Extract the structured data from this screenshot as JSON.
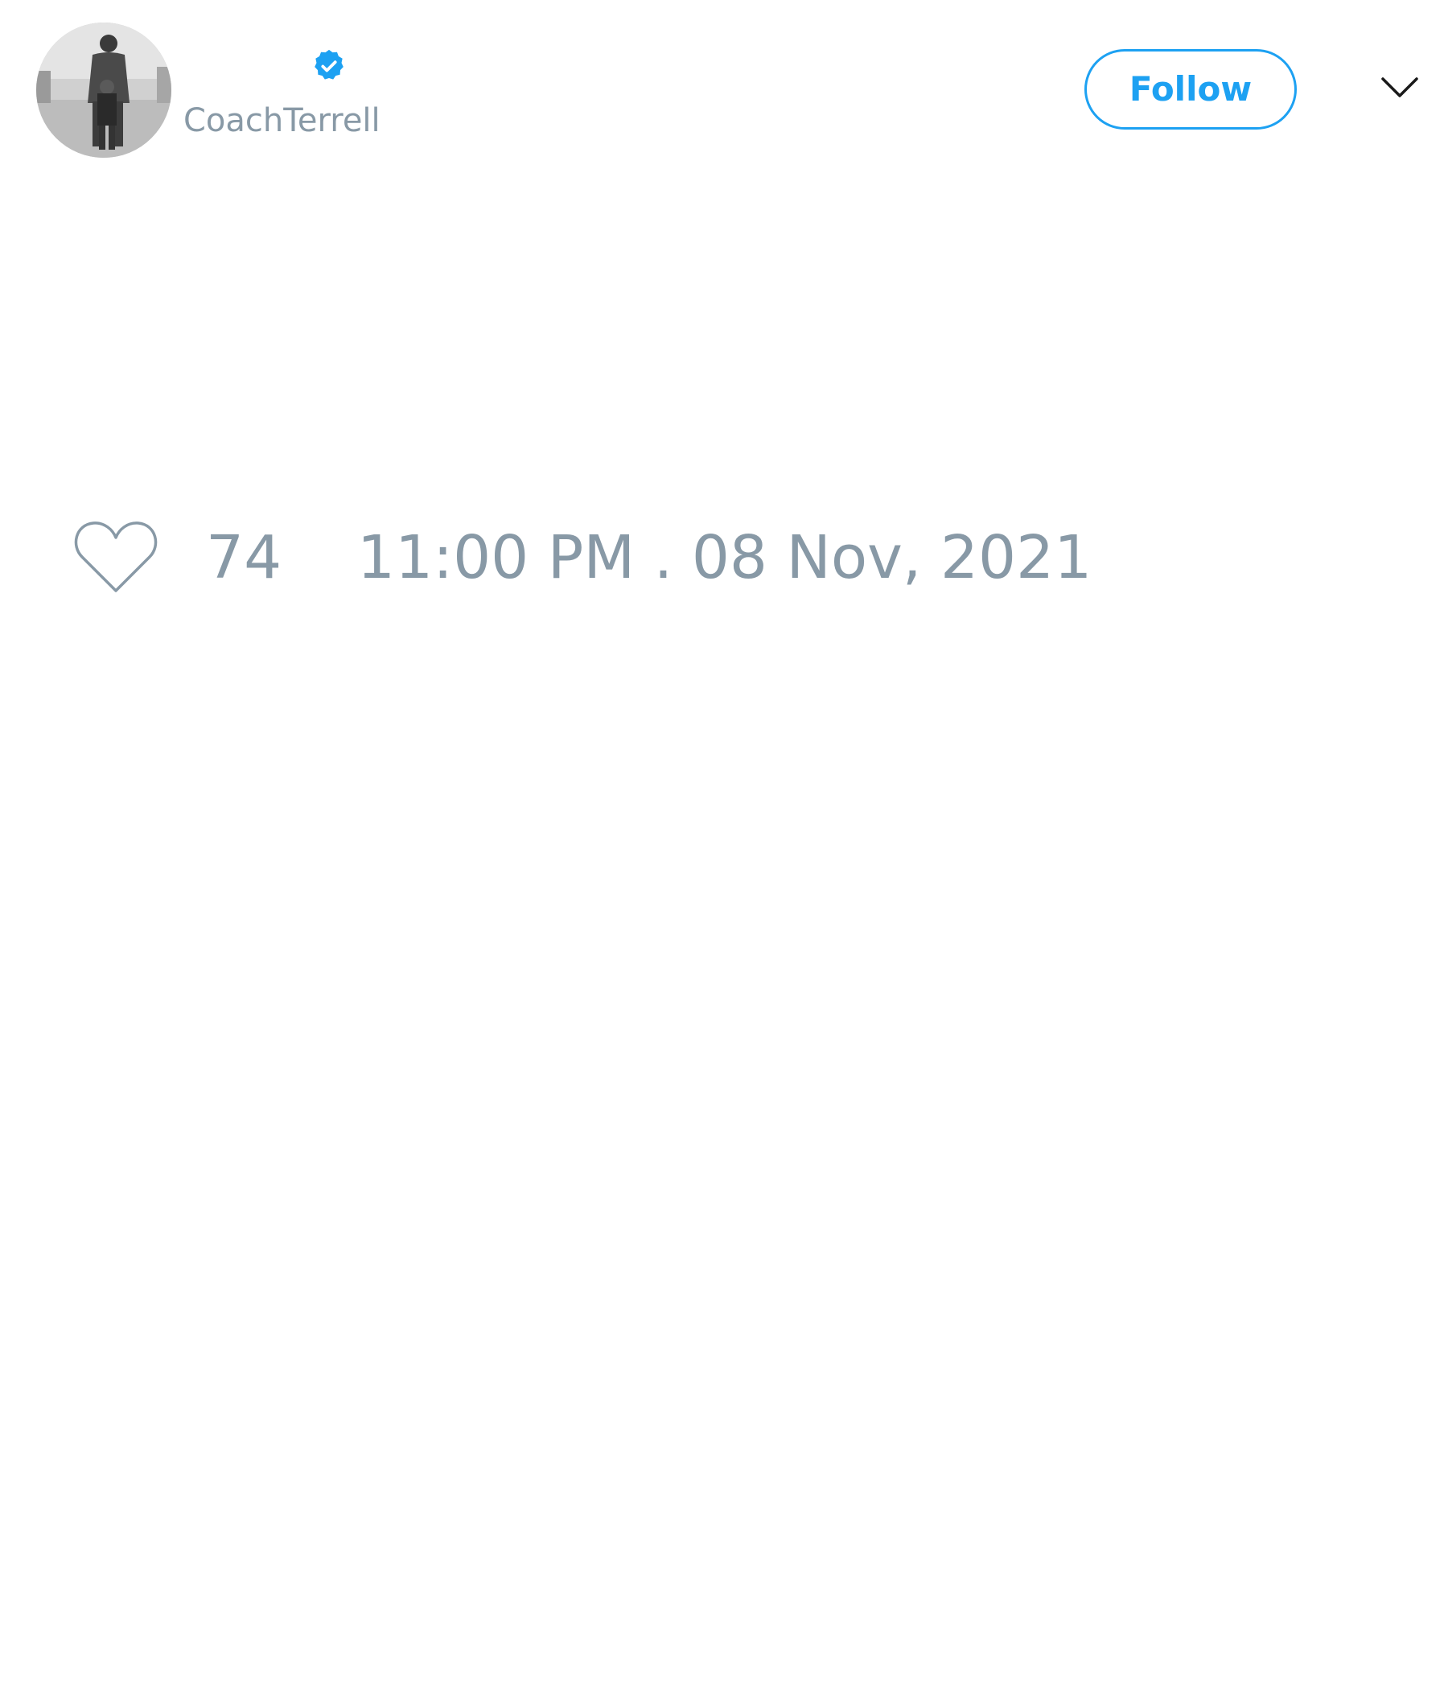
{
  "tweet": {
    "author": {
      "display_name": "",
      "handle": "CoachTerrell",
      "verified": true,
      "avatar_icon": "grayscale-photo-person-with-child"
    },
    "follow_label": "Follow",
    "menu_icon": "chevron-down-icon",
    "likes": {
      "icon": "heart-outline-icon",
      "count": "74"
    },
    "timestamp": "11:00 PM . 08 Nov, 2021"
  },
  "colors": {
    "accent": "#1da1f2",
    "muted_text": "#8899a6",
    "background": "#ffffff"
  }
}
